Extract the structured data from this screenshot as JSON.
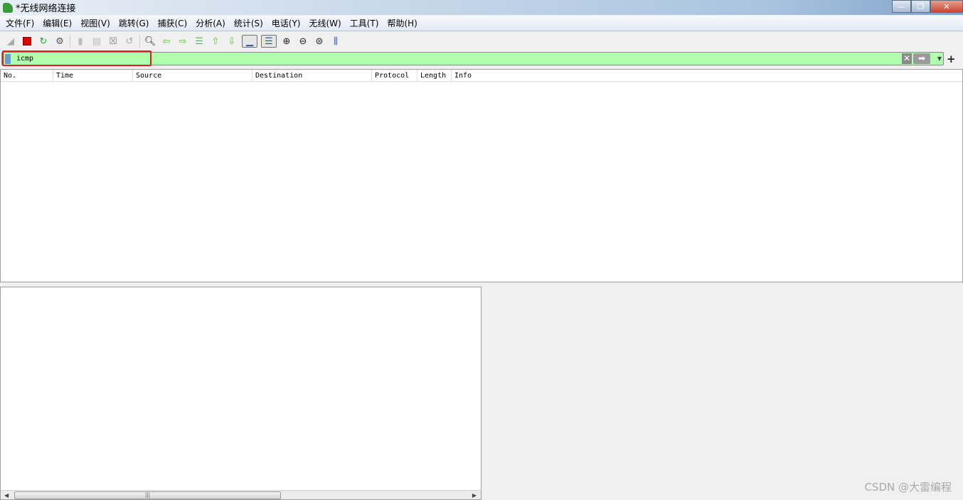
{
  "window": {
    "title": "*无线网络连接",
    "controls": {
      "minimize": "—",
      "maximize": "❐",
      "close": "✕"
    }
  },
  "menu": [
    "文件(F)",
    "编辑(E)",
    "视图(V)",
    "跳转(G)",
    "捕获(C)",
    "分析(A)",
    "统计(S)",
    "电话(Y)",
    "无线(W)",
    "工具(T)",
    "帮助(H)"
  ],
  "toolbar": [
    "start-capture",
    "stop-capture",
    "restart-capture",
    "capture-options",
    "open-file",
    "save-file",
    "close-file",
    "reload-file",
    "find-packet",
    "go-back",
    "go-forward",
    "go-to-packet",
    "first-packet",
    "last-packet",
    "auto-scroll",
    "colorize",
    "zoom-in",
    "zoom-out",
    "zoom-normal",
    "resize-columns"
  ],
  "filter": {
    "value": "icmp",
    "bg_color": "#afffaf",
    "highlight_color": "#e02020"
  },
  "packet_list": {
    "columns": [
      "No.",
      "Time",
      "Source",
      "Destination",
      "Protocol",
      "Length",
      "Info"
    ]
  },
  "watermark": "CSDN @大雷编程"
}
